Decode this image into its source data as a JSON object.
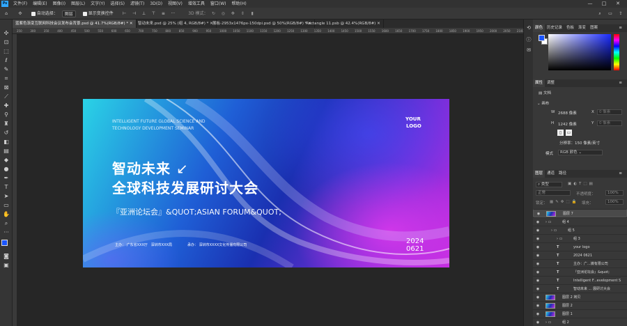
{
  "app": {
    "logo": "Ps",
    "window_controls": [
      "—",
      "□",
      "✕"
    ]
  },
  "menubar": {
    "items": [
      "文件(F)",
      "编辑(E)",
      "图像(I)",
      "图层(L)",
      "文字(Y)",
      "选择(S)",
      "滤镜(T)",
      "3D(D)",
      "视图(V)",
      "增效工具",
      "窗口(W)",
      "帮助(H)"
    ]
  },
  "options": {
    "move_icon": "✣",
    "auto_select_label": "自动选择：",
    "auto_select_value": "图层",
    "show_transform_label": "显示变换控件",
    "mode_3d_label": "3D 模式："
  },
  "tabs": [
    {
      "label": "蓝紫色渐变互联网科技会议发布会背景.psd @ 41.7%(RGB/8#) *",
      "active": true
    },
    {
      "label": "智动未来.psd @ 25% (组 4, RGB/8#) *",
      "active": false
    },
    {
      "label": "展板-2953x1476px-150dpi.psd @ 50%(RGB/8#) *",
      "active": false
    },
    {
      "label": "Rectangle 11.psb @ 42.4%(RGB/8#)",
      "active": false
    }
  ],
  "ruler_ticks": [
    "250",
    "300",
    "350",
    "400",
    "450",
    "500",
    "550",
    "600",
    "650",
    "700",
    "750",
    "800",
    "850",
    "900",
    "950",
    "1000",
    "1050",
    "1100",
    "1150",
    "1200",
    "1250",
    "1300",
    "1350",
    "1400",
    "1450",
    "1500",
    "1550",
    "1600",
    "1650",
    "1700",
    "1750",
    "1800",
    "1850",
    "1900",
    "1950",
    "2000",
    "2050",
    "2100"
  ],
  "artboard": {
    "top_line1": "INTELLIGENT FUTURE GLOBAL SCIENCE AND",
    "top_line2": "TECHNOLOGY DEVELOPMENT SEMINAR",
    "logo_line1": "YOUR",
    "logo_line2": "LOGO",
    "title1": "智动未来",
    "title_arrow": "↙",
    "title2": "全球科技发展研讨大会",
    "subtitle": "『亚洲论坛会』&QUOT;ASIAN FORUM&QUOT;",
    "host_label": "主办：",
    "host_value": "广东省XXX厅",
    "host_value2": "深圳市XXX局",
    "cohost_label": "承办：",
    "cohost_value": "深圳市XXXX文化传播有限公司",
    "year": "2024",
    "date": "0621"
  },
  "color_panel": {
    "tabs": [
      "颜色",
      "历史记录",
      "色板",
      "渐变",
      "图案"
    ],
    "hue_color": "#1a2bff"
  },
  "properties_panel": {
    "tabs": [
      "属性",
      "调整"
    ],
    "doc_label": "文档",
    "canvas_label": "画布",
    "w_label": "W",
    "w_value": "2688 像素",
    "x_label": "X",
    "x_placeholder": "0 像素",
    "h_label": "H",
    "h_value": "1242 像素",
    "y_label": "Y",
    "y_placeholder": "0 像素",
    "resolution": "分辨率：150 像素/英寸",
    "mode_label": "模式",
    "mode_value": "RGB 颜色"
  },
  "layers_panel": {
    "tabs": [
      "图层",
      "通道",
      "路径"
    ],
    "filter_value": "类型",
    "blend_mode": "正常",
    "opacity_label": "不透明度：",
    "opacity_value": "100%",
    "lock_label": "锁定：",
    "fill_label": "填充：",
    "fill_value": "100%",
    "layers": [
      {
        "name": "图层 7",
        "type": "image",
        "indent": 0
      },
      {
        "name": "组 4",
        "type": "group",
        "indent": 0
      },
      {
        "name": "组 5",
        "type": "group",
        "indent": 1
      },
      {
        "name": "组 3",
        "type": "group",
        "indent": 2
      },
      {
        "name": "your logo",
        "type": "text",
        "indent": 2
      },
      {
        "name": "2024 0621",
        "type": "text",
        "indent": 2
      },
      {
        "name": "主办：广...媒有限公司",
        "type": "text",
        "indent": 2
      },
      {
        "name": "『亚洲论坛会』&quot;",
        "type": "text",
        "indent": 2
      },
      {
        "name": "Intelligent F...evelopment S",
        "type": "text",
        "indent": 2
      },
      {
        "name": "智动未来 ... 展研讨大会",
        "type": "text",
        "indent": 2
      },
      {
        "name": "图层 2 拷贝",
        "type": "image",
        "indent": 0
      },
      {
        "name": "图层 2",
        "type": "image",
        "indent": 0
      },
      {
        "name": "图层 1",
        "type": "image",
        "indent": 0
      },
      {
        "name": "组 2",
        "type": "group",
        "indent": 0
      }
    ]
  }
}
